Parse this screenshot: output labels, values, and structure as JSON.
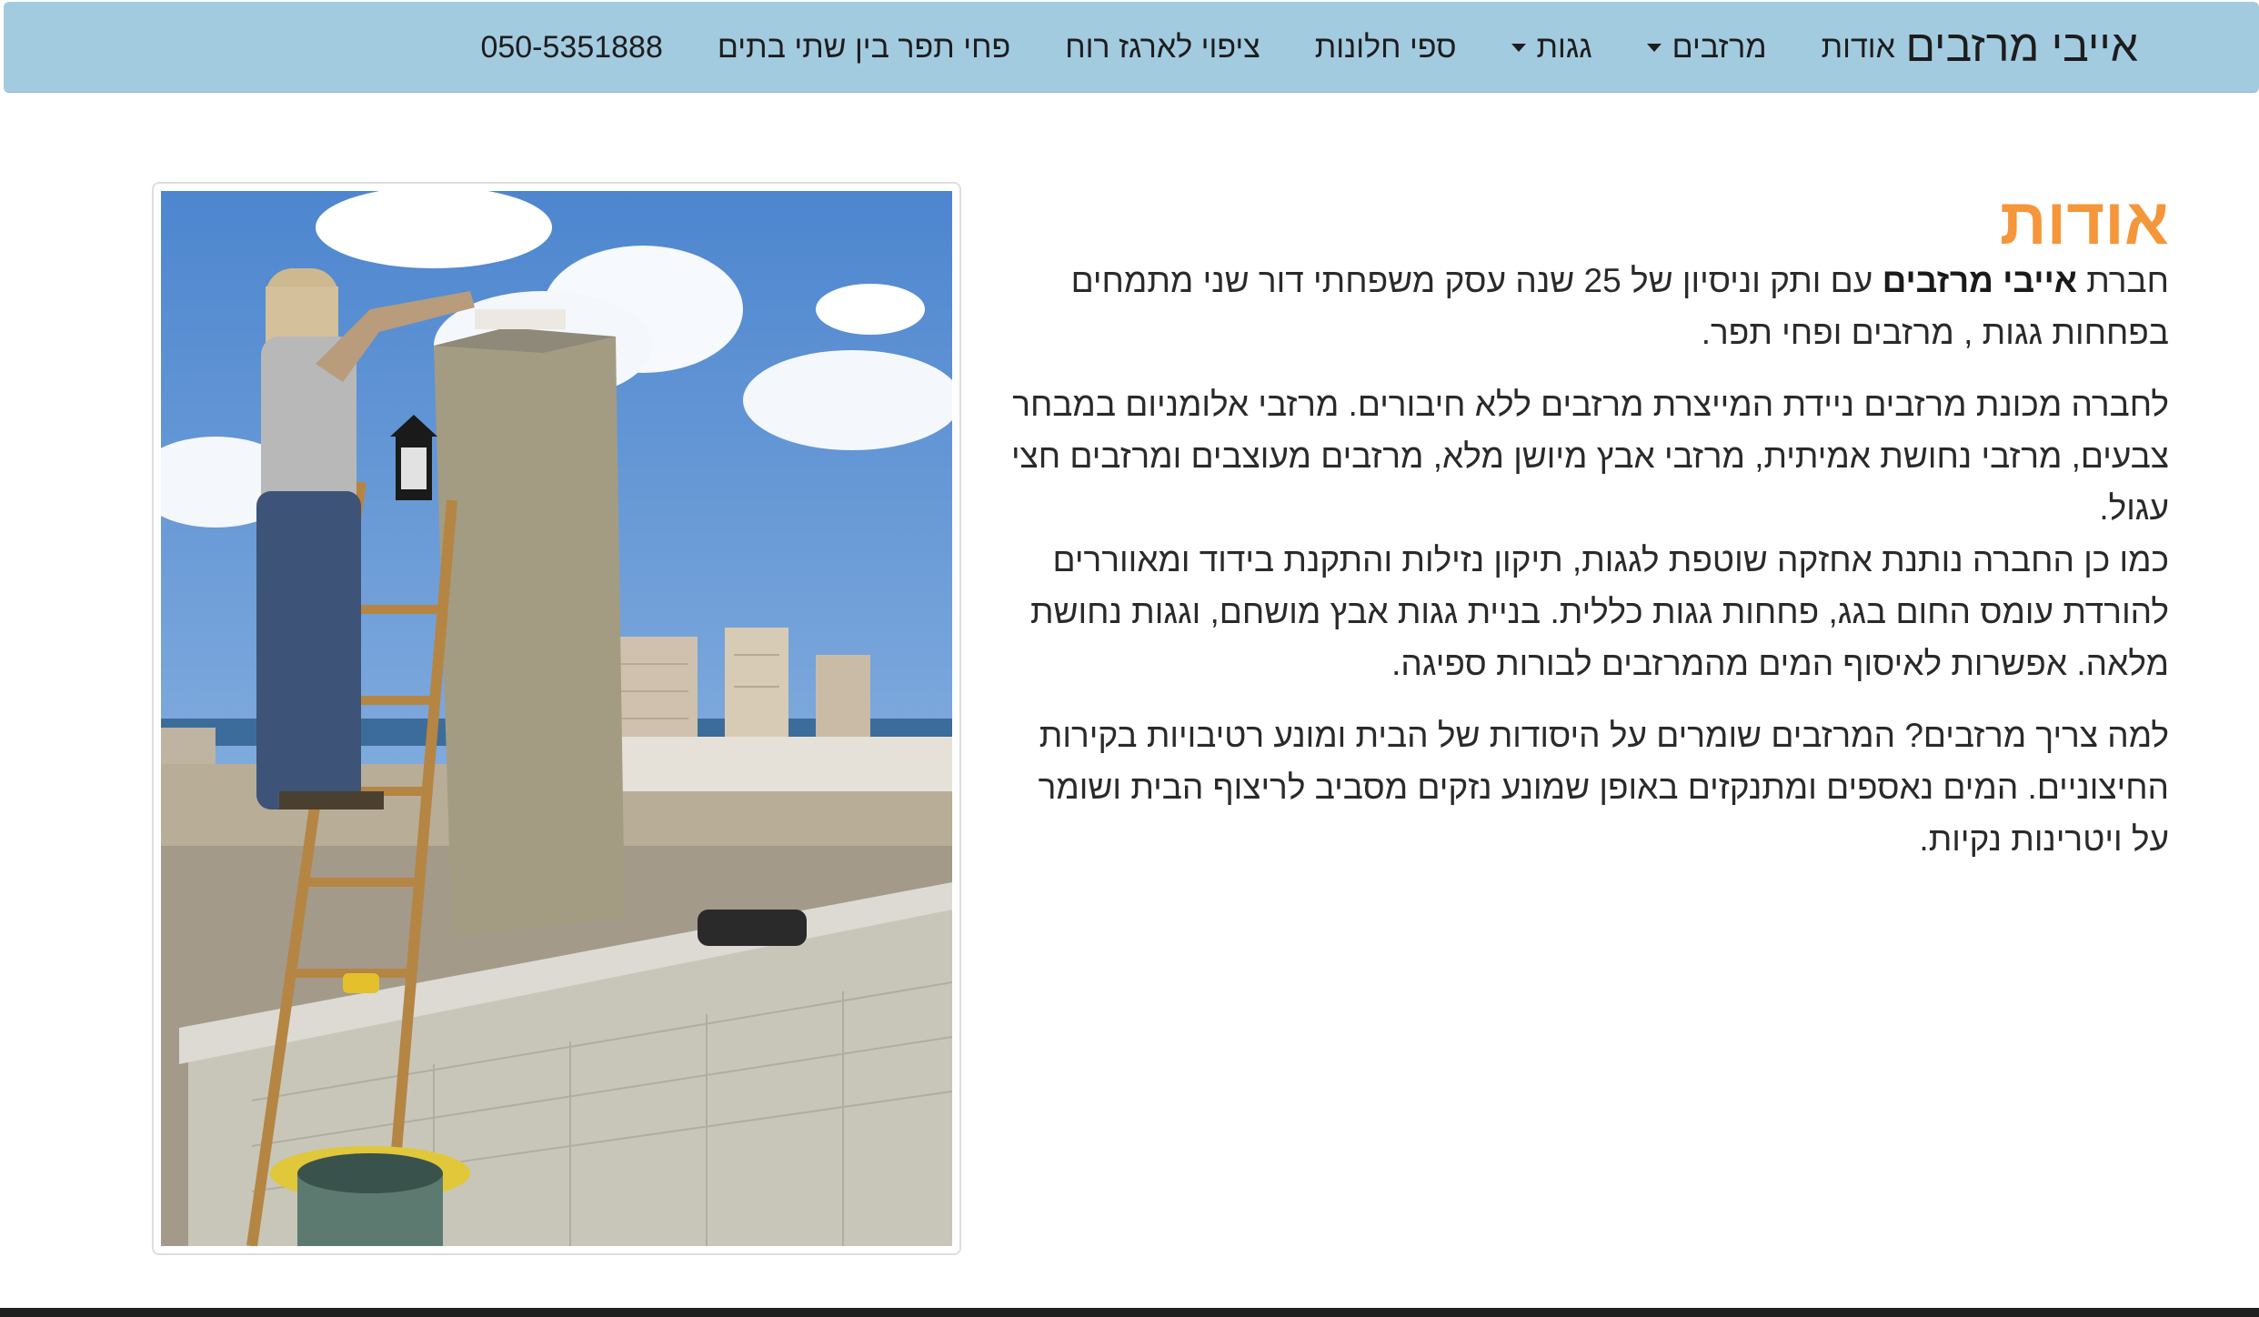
{
  "navbar": {
    "brand": "אייבי מרזבים",
    "items": [
      {
        "label": "אודות",
        "dropdown": false
      },
      {
        "label": "מרזבים",
        "dropdown": true
      },
      {
        "label": "גגות",
        "dropdown": true
      },
      {
        "label": "ספי חלונות",
        "dropdown": false
      },
      {
        "label": "ציפוי לארגז רוח",
        "dropdown": false
      },
      {
        "label": "פחי תפר בין שתי בתים",
        "dropdown": false
      },
      {
        "label": "050-5351888",
        "dropdown": false
      }
    ]
  },
  "about": {
    "title": "אודות",
    "p1_prefix": "חברת",
    "p1_bold": "אייבי מרזבים",
    "p1_rest": "עם ותק וניסיון של 25 שנה עסק משפחתי דור שני מתמחים בפחחות גגות , מרזבים ופחי תפר.",
    "p2": "לחברה מכונת מרזבים ניידת המייצרת מרזבים ללא חיבורים. מרזבי אלומניום במבחר צבעים, מרזבי נחושת אמיתית, מרזבי אבץ מיושן מלא, מרזבים מעוצבים ומרזבים חצי עגול.",
    "p3": "כמו כן החברה נותנת אחזקה שוטפת לגגות, תיקון נזילות והתקנת בידוד ומאווררים להורדת עומס החום בגג, פחחות גגות כללית. בניית גגות אבץ מושחם, וגגות נחושת מלאה. אפשרות לאיסוף המים מהמרזבים לבורות ספיגה.",
    "p4": "למה צריך מרזבים? המרזבים שומרים על היסודות של הבית ומונע רטיבויות בקירות החיצוניים. המים נאספים ומתנקזים באופן שמונע נזקים מסביב לריצוף הבית ושומר על ויטרינות נקיות."
  },
  "colors": {
    "navbar_bg": "#a3cbe0",
    "title_accent": "#f5963a",
    "footer": "#1f1f1f"
  },
  "photo": {
    "alt_icon": "worker-on-ladder-photo"
  }
}
